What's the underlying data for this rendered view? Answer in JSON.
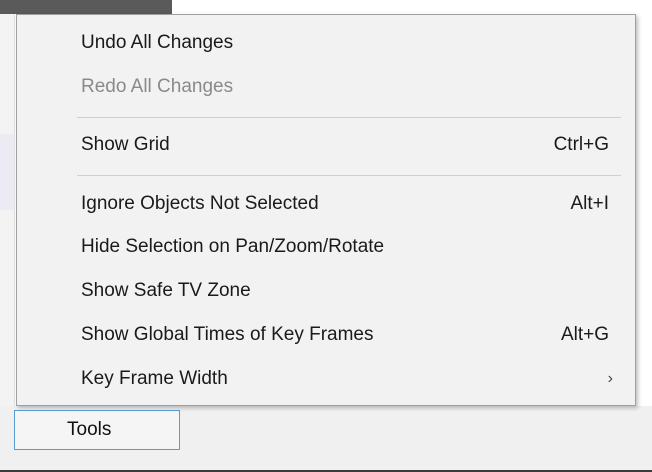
{
  "menu": {
    "items": [
      {
        "label": "Undo All Changes",
        "shortcut": "",
        "enabled": true
      },
      {
        "label": "Redo All Changes",
        "shortcut": "",
        "enabled": false
      },
      {
        "label": "Show Grid",
        "shortcut": "Ctrl+G",
        "enabled": true
      },
      {
        "label": "Ignore Objects Not Selected",
        "shortcut": "Alt+I",
        "enabled": true
      },
      {
        "label": "Hide Selection on Pan/Zoom/Rotate",
        "shortcut": "",
        "enabled": true
      },
      {
        "label": "Show Safe TV Zone",
        "shortcut": "",
        "enabled": true
      },
      {
        "label": "Show Global Times of Key Frames",
        "shortcut": "Alt+G",
        "enabled": true
      },
      {
        "label": "Key Frame Width",
        "shortcut": "",
        "enabled": true,
        "submenu_glyph": "›"
      }
    ]
  },
  "tabs": {
    "tools_label": "Tools"
  }
}
